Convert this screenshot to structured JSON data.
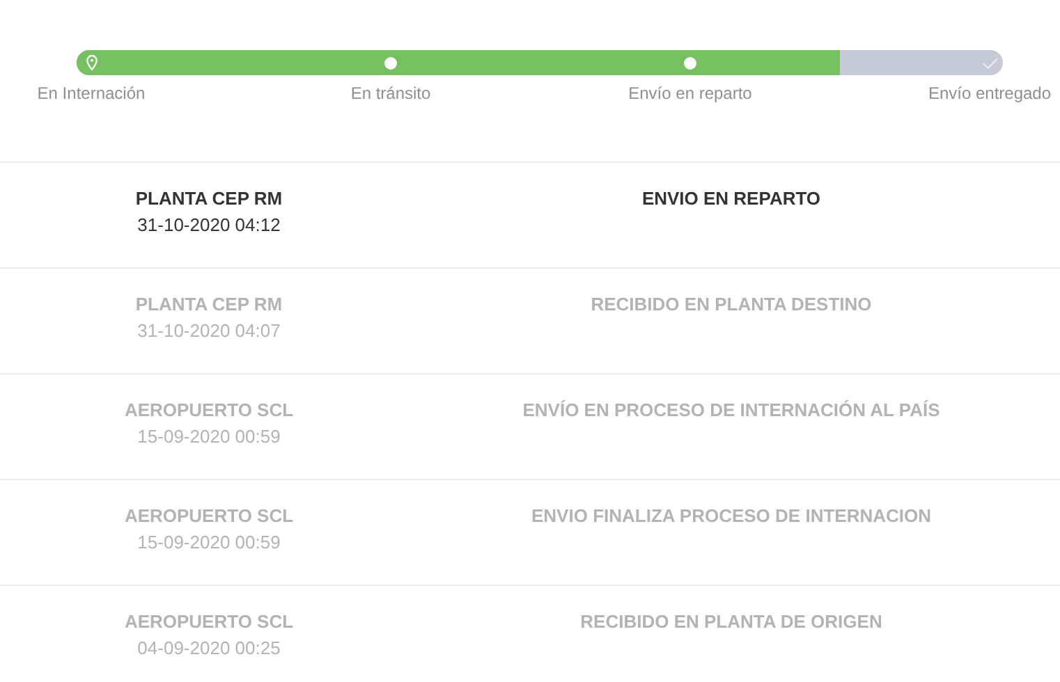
{
  "progress": {
    "level": 0.824,
    "steps": [
      {
        "label": "En Internación",
        "kind": "pin",
        "completed": true
      },
      {
        "label": "En tránsito",
        "kind": "dot",
        "completed": true
      },
      {
        "label": "Envío en reparto",
        "kind": "dot",
        "completed": true
      },
      {
        "label": "Envío entregado",
        "kind": "check",
        "completed": false
      }
    ]
  },
  "events": [
    {
      "place": "PLANTA CEP RM",
      "datetime": "31-10-2020 04:12",
      "status": "ENVIO EN REPARTO",
      "current": true
    },
    {
      "place": "PLANTA CEP RM",
      "datetime": "31-10-2020 04:07",
      "status": "RECIBIDO EN PLANTA DESTINO",
      "current": false
    },
    {
      "place": "AEROPUERTO SCL",
      "datetime": "15-09-2020 00:59",
      "status": "ENVÍO EN PROCESO DE INTERNACIÓN AL PAÍS",
      "current": false
    },
    {
      "place": "AEROPUERTO SCL",
      "datetime": "15-09-2020 00:59",
      "status": "ENVIO FINALIZA PROCESO DE INTERNACION",
      "current": false
    },
    {
      "place": "AEROPUERTO SCL",
      "datetime": "04-09-2020 00:25",
      "status": "RECIBIDO EN PLANTA DE ORIGEN",
      "current": false
    }
  ]
}
